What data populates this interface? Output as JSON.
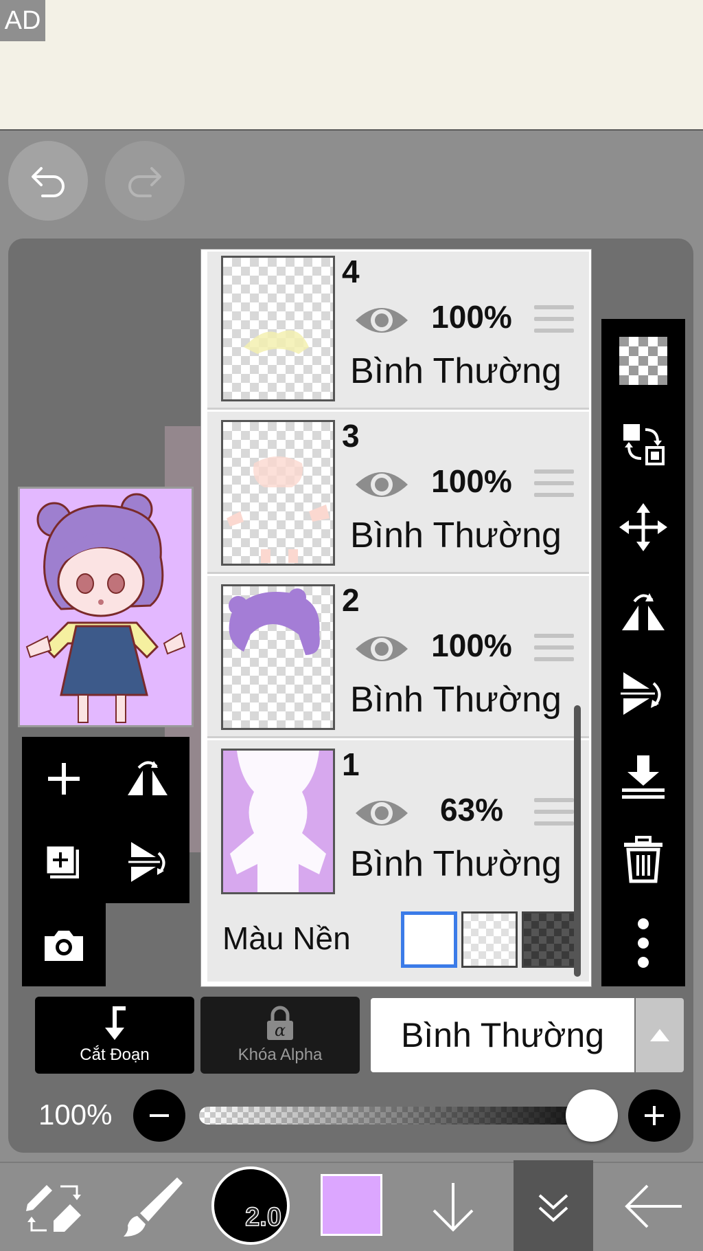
{
  "ad": {
    "label": "AD"
  },
  "layers": [
    {
      "number": "4",
      "opacity": "100%",
      "blend": "Bình Thường"
    },
    {
      "number": "3",
      "opacity": "100%",
      "blend": "Bình Thường"
    },
    {
      "number": "2",
      "opacity": "100%",
      "blend": "Bình Thường"
    },
    {
      "number": "1",
      "opacity": "63%",
      "blend": "Bình Thường"
    }
  ],
  "background": {
    "label": "Màu Nền",
    "options": [
      "white",
      "transparent",
      "dark-checker"
    ],
    "selected": "white"
  },
  "actions": {
    "clipping": "Cắt Đoạn",
    "alpha_lock": "Khóa Alpha",
    "blend_mode": "Bình Thường"
  },
  "opacity": {
    "label": "100%",
    "value": 1.0
  },
  "brush": {
    "size": "2.0",
    "color": "#dca6ff"
  },
  "colors": {
    "accent": "#3b7be8",
    "panel": "#6f6f6f",
    "toolbar": "#8e8e8e"
  }
}
